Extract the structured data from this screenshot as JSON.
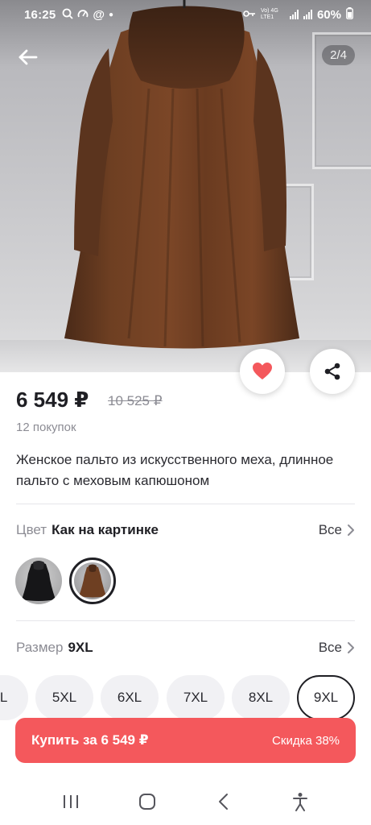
{
  "status_bar": {
    "time": "16:25",
    "battery": "60%",
    "network_label": "Vo) 4G LTE1"
  },
  "gallery": {
    "counter": "2/4"
  },
  "product": {
    "price": "6 549 ₽",
    "old_price": "10 525 ₽",
    "purchases": "12 покупок",
    "title": "Женское пальто из искусственного меха, длинное пальто с меховым капюшоном"
  },
  "color_option": {
    "label": "Цвет",
    "value": "Как на картинке",
    "all_label": "Все"
  },
  "size_option": {
    "label": "Размер",
    "value": "9XL",
    "all_label": "Все",
    "sizes": [
      "XL",
      "5XL",
      "6XL",
      "7XL",
      "8XL",
      "9XL"
    ],
    "selected": "9XL"
  },
  "buy_button": {
    "label": "Купить за 6 549 ₽",
    "discount": "Скидка 38%"
  },
  "colors": {
    "accent": "#f4585c",
    "text_primary": "#1f1f24",
    "text_secondary": "#8c8c94",
    "like_heart": "#f4585c"
  },
  "icons": {
    "back": "arrow-left-icon",
    "like": "heart-icon",
    "share": "share-icon",
    "chevron": "chevron-right-icon",
    "nav_recents": "recents-icon",
    "nav_home": "home-icon",
    "nav_back": "back-icon",
    "nav_accessibility": "accessibility-icon"
  }
}
